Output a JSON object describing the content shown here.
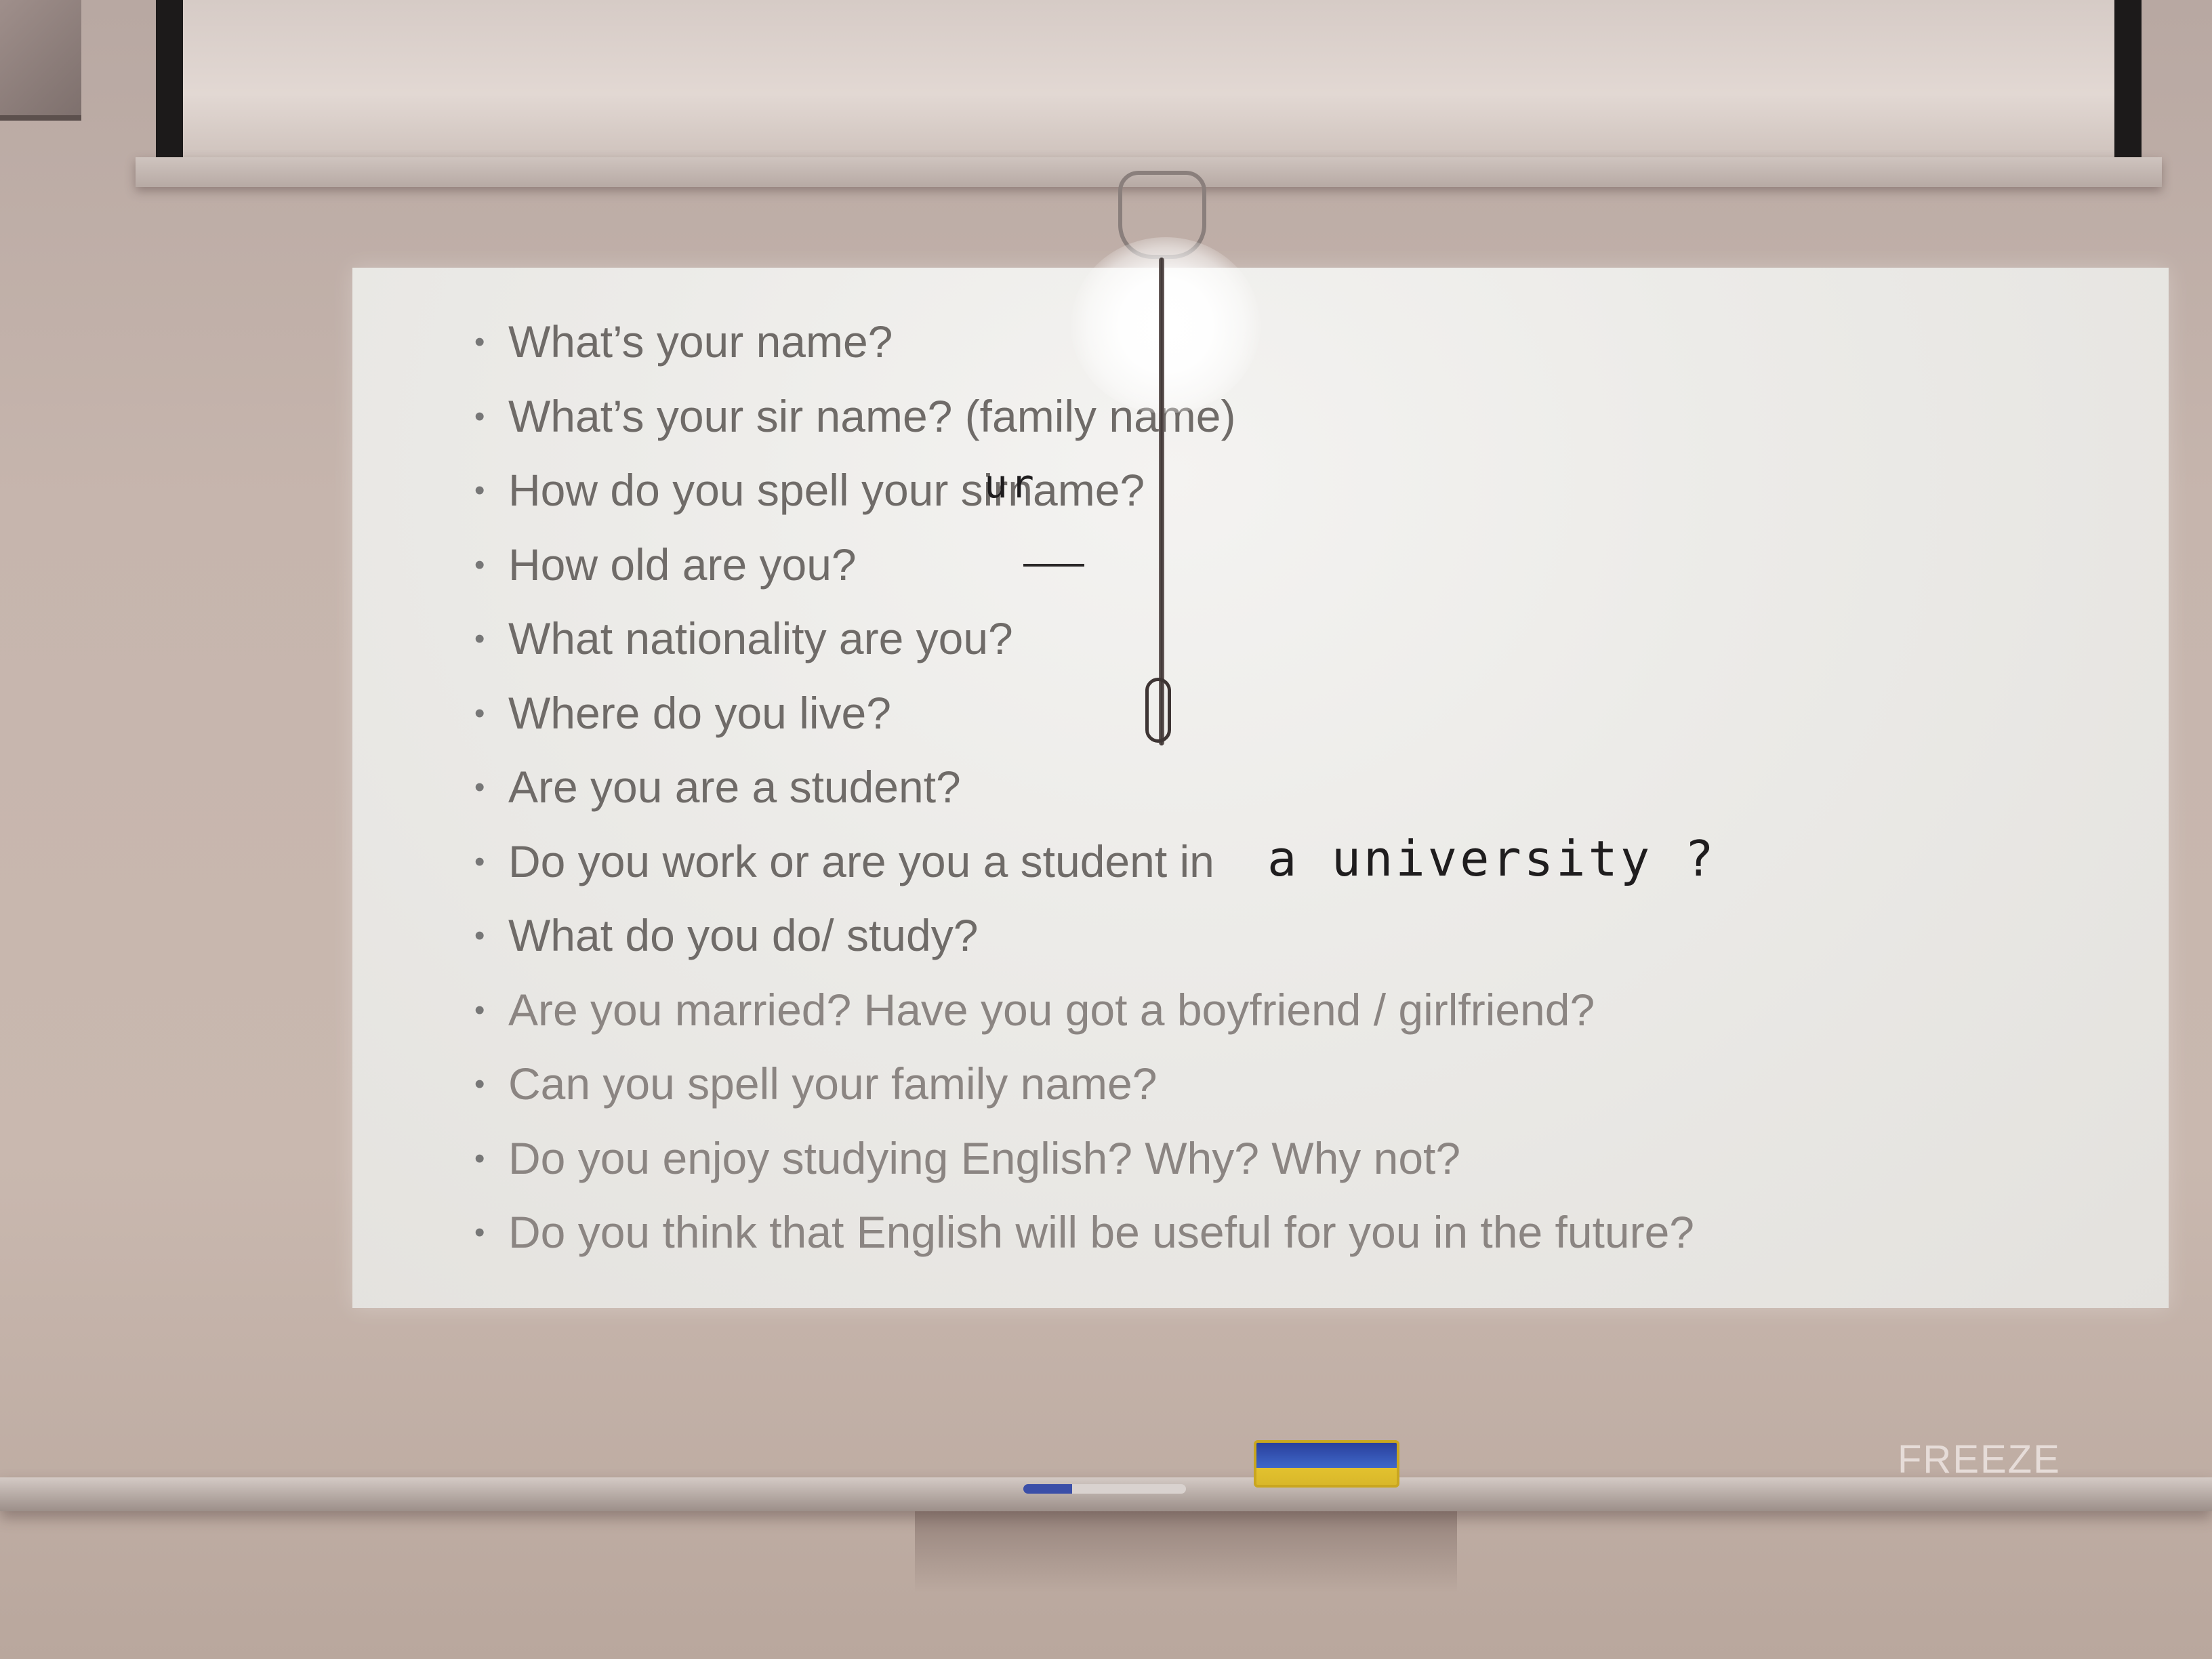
{
  "slide": {
    "questions": [
      "What’s your name?",
      "What’s your sir name? (family name)",
      "How do you spell your sirname?",
      "How old are you?",
      "What nationality are you?",
      "Where do you live?",
      "Are you are a student?",
      "Do you work or are you a student in",
      "What do you do/ study?",
      "Are you married? Have you got a boyfriend / girlfriend?",
      "Can you spell your family name?",
      "Do you enjoy studying English? Why? Why not?",
      "Do you think that English will be useful for you in the future?"
    ],
    "handwritten_addition": "a university ?",
    "handwritten_correction": "ur"
  },
  "board": {
    "corner_label": "FREEZE"
  }
}
